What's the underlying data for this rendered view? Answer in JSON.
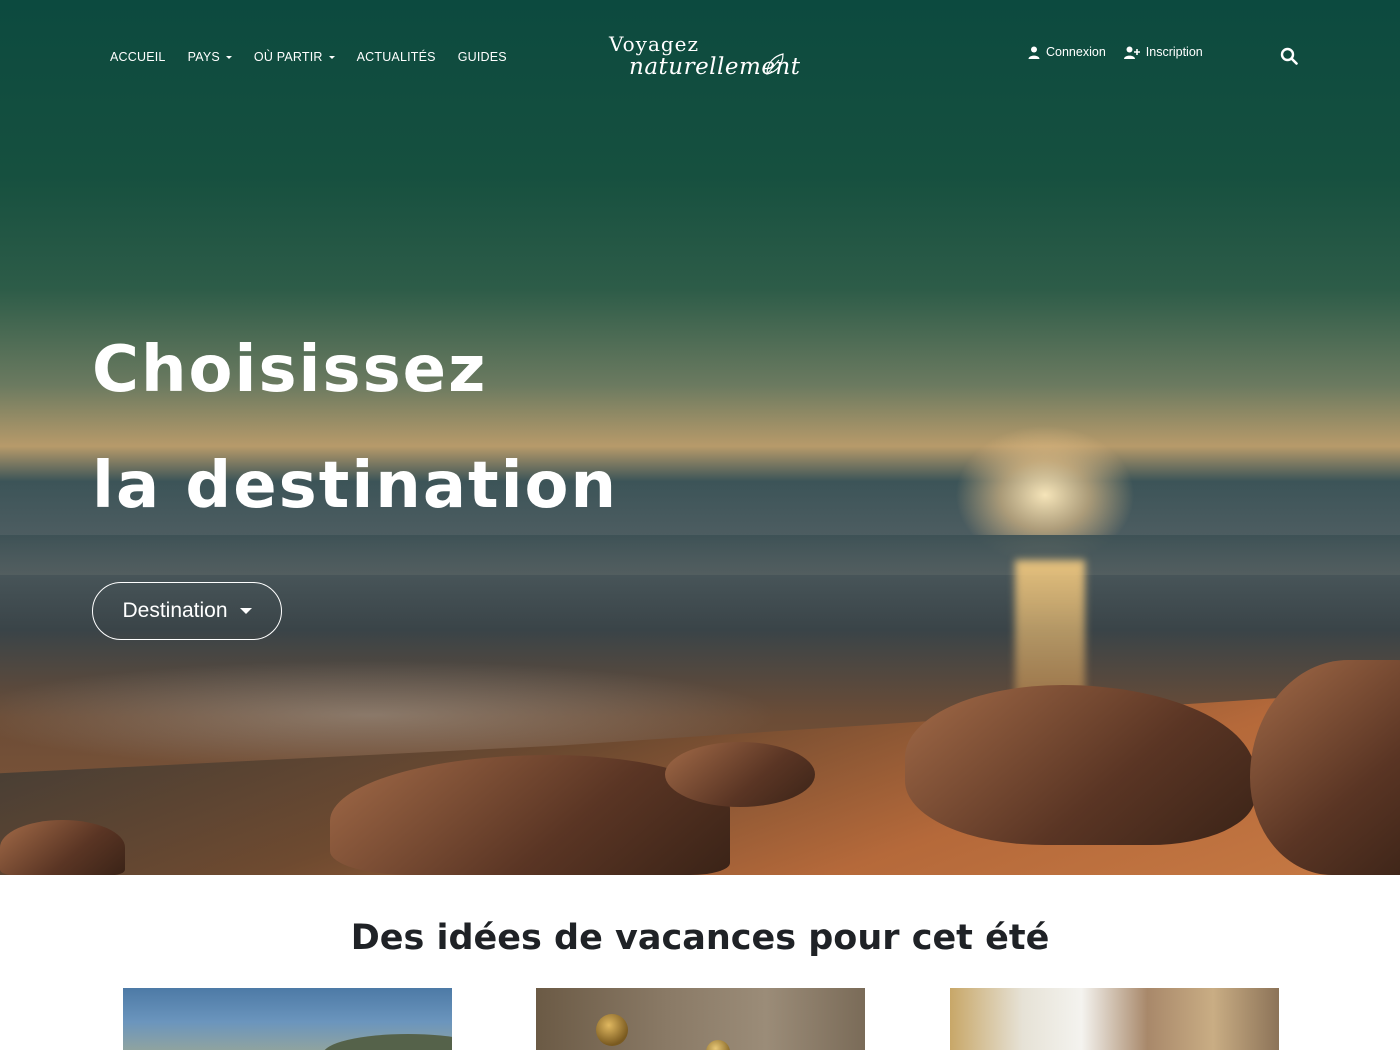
{
  "nav": {
    "items": [
      {
        "label": "ACCUEIL",
        "dropdown": false
      },
      {
        "label": "PAYS",
        "dropdown": true
      },
      {
        "label": "OÙ PARTIR",
        "dropdown": true
      },
      {
        "label": "ACTUALITÉS",
        "dropdown": false
      },
      {
        "label": "GUIDES",
        "dropdown": false
      }
    ]
  },
  "logo": {
    "line1": "Voyagez",
    "line2": "naturellement"
  },
  "auth": {
    "login": "Connexion",
    "signup": "Inscription"
  },
  "hero": {
    "headline_line1": "Choisissez",
    "headline_line2": "la destination",
    "destination_button": "Destination"
  },
  "section": {
    "title": "Des idées de vacances pour cet été"
  },
  "icons": [
    "user-icon",
    "user-plus-icon",
    "search-icon",
    "leaf-icon",
    "caret-down-icon"
  ],
  "colors": {
    "hero_top": "#0c4a3f",
    "text_light": "#ffffff",
    "title_dark": "#1f2226"
  }
}
